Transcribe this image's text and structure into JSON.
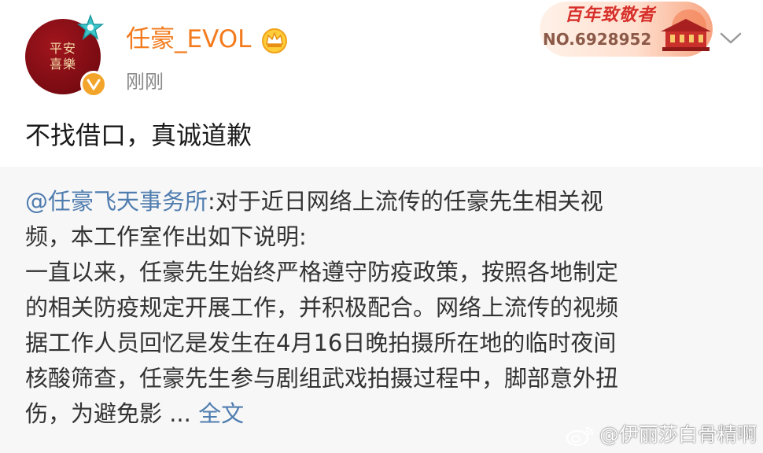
{
  "post": {
    "avatar_text": [
      "平安",
      "喜樂"
    ],
    "username": "任豪_EVOL",
    "timestamp": "刚刚",
    "text": "不找借口，真诚道歉",
    "fan_badge": {
      "title": "百年致敬者",
      "number": "NO.6928952"
    }
  },
  "repost": {
    "mention": "@任豪飞天事务所",
    "line1_rest": ":对于近日网络上流传的任豪先生相关视",
    "line2": "频，本工作室作出如下说明:",
    "line3": "一直以来，任豪先生始终严格遵守防疫政策，按照各地制定",
    "line4": "的相关防疫规定开展工作，并积极配合。网络上流传的视频",
    "line5": "据工作人员回忆是发生在4月16日晚拍摄所在地的临时夜间",
    "line6": "核酸筛查，任豪先生参与剧组武戏拍摄过程中，脚部意外扭",
    "line7": "伤，为避免影 ...",
    "more_label": "全文"
  },
  "watermark": {
    "text": "@伊丽莎白骨精啊"
  },
  "colors": {
    "username": "#f37b1d",
    "link": "#507daf",
    "repost_bg": "#f7f7f7",
    "badge_red": "#d7302b"
  },
  "icons": [
    "crown-icon",
    "verified-icon",
    "chevron-down-icon",
    "weibo-icon"
  ]
}
